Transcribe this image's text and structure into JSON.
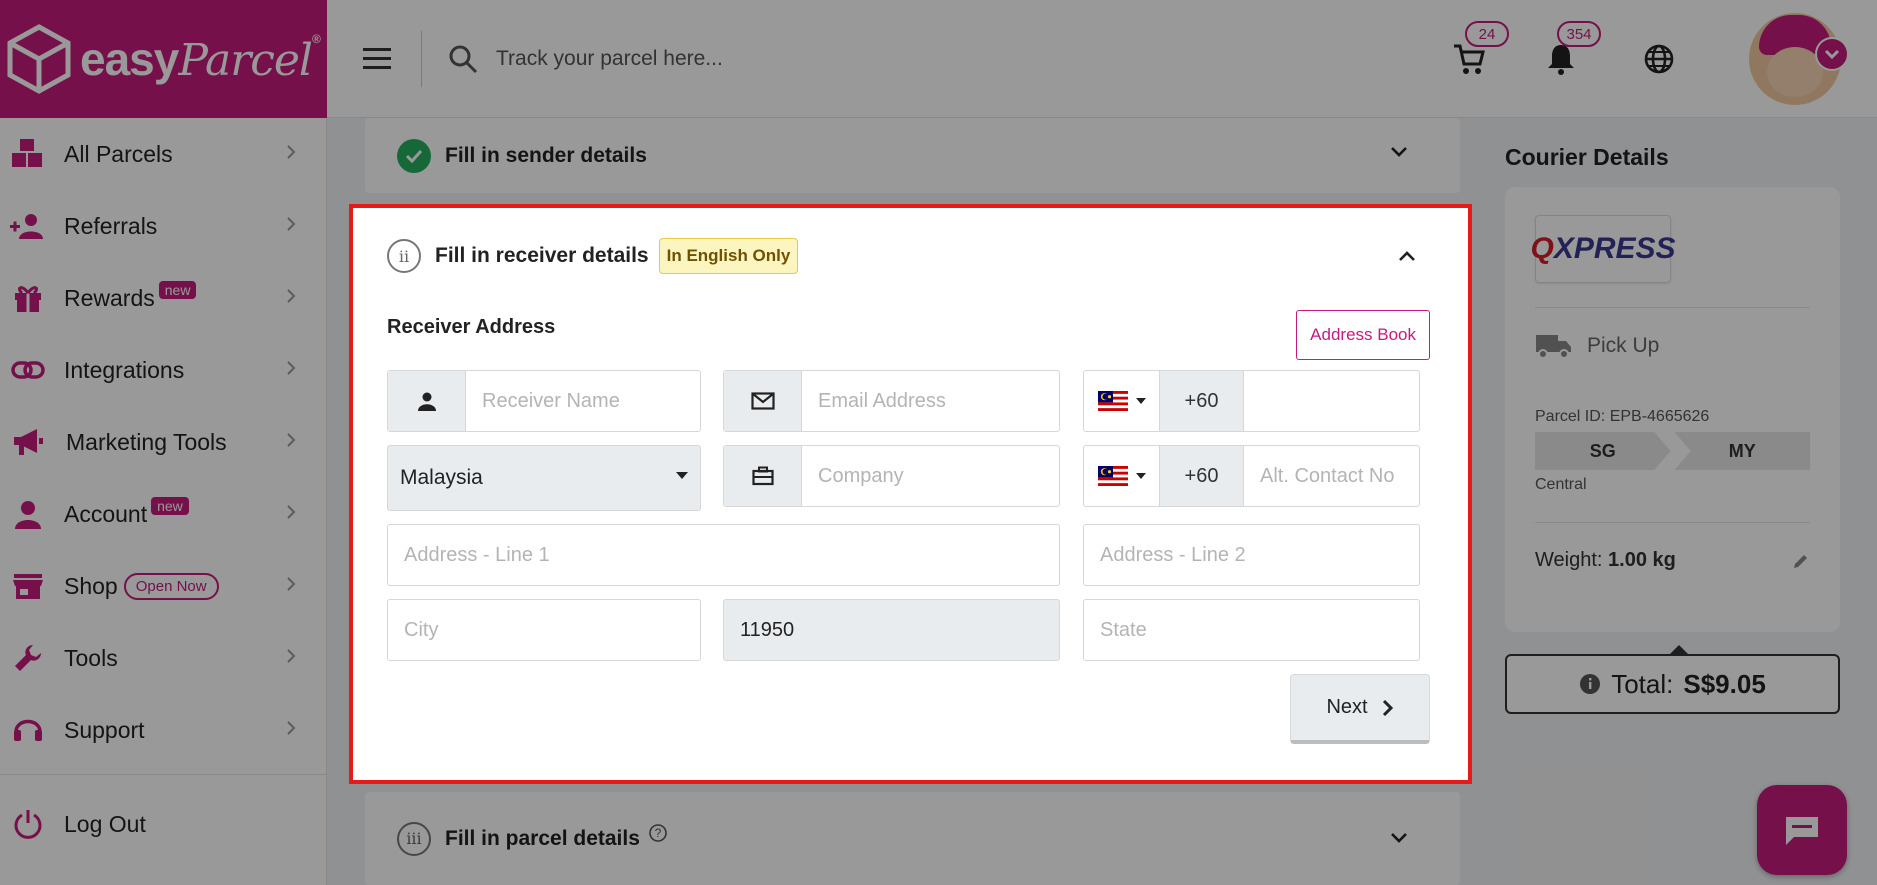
{
  "brand": {
    "name_bold": "easy",
    "name_script": "Parcel",
    "reg": "®"
  },
  "topbar": {
    "search_placeholder": "Track your parcel here...",
    "cart_count": "24",
    "notification_count": "354"
  },
  "sidebar": {
    "items": [
      {
        "label": "All Parcels",
        "icon": "parcels-icon"
      },
      {
        "label": "Referrals",
        "icon": "referrals-icon"
      },
      {
        "label": "Rewards",
        "icon": "gift-icon",
        "badge": "new"
      },
      {
        "label": "Integrations",
        "icon": "link-icon"
      },
      {
        "label": "Marketing Tools",
        "icon": "megaphone-icon"
      },
      {
        "label": "Account",
        "icon": "user-icon",
        "badge": "new"
      },
      {
        "label": "Shop",
        "icon": "store-icon",
        "pill": "Open Now"
      },
      {
        "label": "Tools",
        "icon": "wrench-icon"
      },
      {
        "label": "Support",
        "icon": "headset-icon"
      }
    ],
    "logout": "Log Out"
  },
  "steps": {
    "sender": {
      "title": "Fill in sender details"
    },
    "receiver": {
      "numeral": "ii",
      "title": "Fill in receiver details",
      "tag": "In English Only",
      "section_label": "Receiver Address",
      "address_book": "Address Book",
      "fields": {
        "name_placeholder": "Receiver Name",
        "email_placeholder": "Email Address",
        "phone_code": "+60",
        "phone_value": "",
        "country": "Malaysia",
        "company_placeholder": "Company",
        "alt_phone_code": "+60",
        "alt_phone_placeholder": "Alt. Contact No",
        "address1_placeholder": "Address - Line 1",
        "address2_placeholder": "Address - Line 2",
        "city_placeholder": "City",
        "postcode": "11950",
        "state_placeholder": "State"
      },
      "next": "Next"
    },
    "parcel": {
      "numeral": "iii",
      "title": "Fill in parcel details"
    }
  },
  "courier": {
    "title": "Courier Details",
    "logo_q": "Q",
    "logo_rest": "XPRESS",
    "service": "Pick Up",
    "parcel_id": "Parcel ID: EPB-4665626",
    "from": "SG",
    "to": "MY",
    "region": "Central",
    "weight_label": "Weight:",
    "weight_value": "1.00 kg",
    "total_label": "Total:",
    "total_value": "S$9.05"
  },
  "colors": {
    "brand": "#c51b7d",
    "highlight": "#e41b1b",
    "success": "#27ae60"
  }
}
